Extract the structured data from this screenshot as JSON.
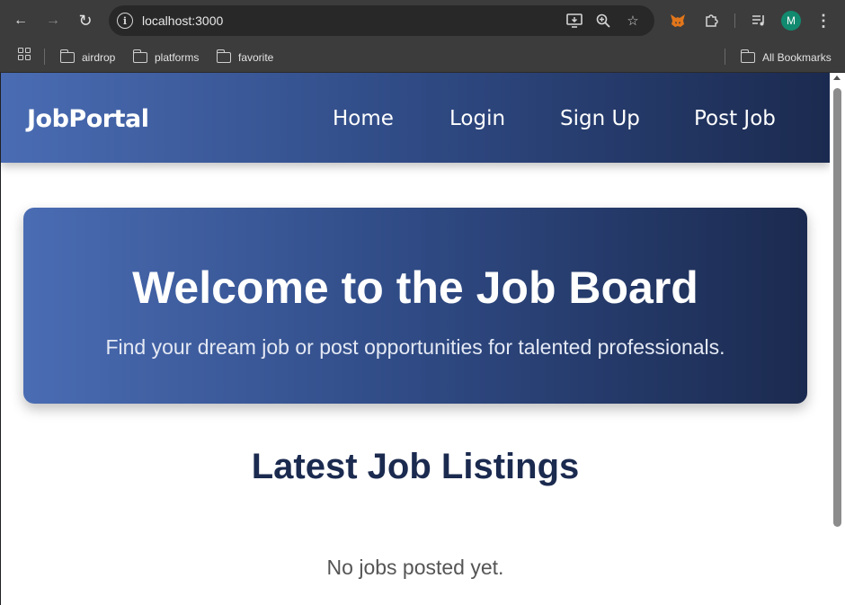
{
  "browser": {
    "url": "localhost:3000",
    "avatar_initial": "M",
    "bookmarks": [
      {
        "label": "airdrop"
      },
      {
        "label": "platforms"
      },
      {
        "label": "favorite"
      }
    ],
    "all_bookmarks_label": "All Bookmarks"
  },
  "site": {
    "brand": "JobPortal",
    "nav": {
      "home": "Home",
      "login": "Login",
      "signup": "Sign Up",
      "post_job": "Post Job"
    }
  },
  "hero": {
    "title": "Welcome to the Job Board",
    "subtitle": "Find your dream job or post opportunities for talented professionals."
  },
  "listings": {
    "title": "Latest Job Listings",
    "empty_message": "No jobs posted yet."
  },
  "colors": {
    "gradient_start": "#4a6cb3",
    "gradient_end": "#1b2a4f",
    "heading": "#1b2a4f",
    "avatar": "#128a6f"
  }
}
